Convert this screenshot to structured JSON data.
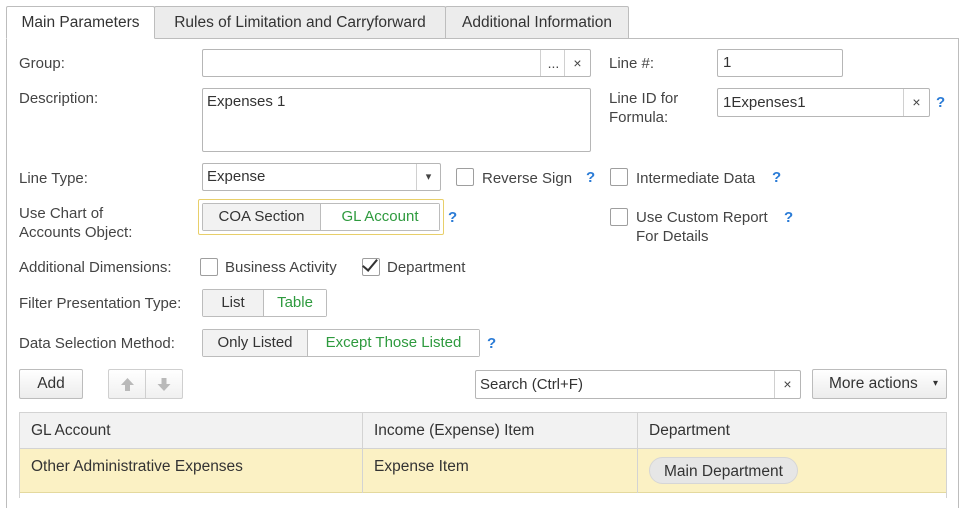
{
  "tabs": [
    {
      "label": "Main Parameters",
      "active": true
    },
    {
      "label": "Rules of Limitation and Carryforward",
      "active": false
    },
    {
      "label": "Additional Information",
      "active": false
    }
  ],
  "form": {
    "group": {
      "label": "Group:",
      "value": "",
      "select_icon": "...",
      "clear_icon": "×"
    },
    "line_no": {
      "label": "Line #:",
      "value": "1"
    },
    "description": {
      "label": "Description:",
      "value": "Expenses 1"
    },
    "line_id": {
      "label_line1": "Line ID for",
      "label_line2": "Formula:",
      "value": "1Expenses1",
      "clear_icon": "×",
      "help": "?"
    },
    "line_type": {
      "label": "Line Type:",
      "value": "Expense",
      "dropdown_icon": "▾"
    },
    "reverse_sign": {
      "label": "Reverse Sign",
      "checked": false,
      "help": "?"
    },
    "intermediate_data": {
      "label": "Intermediate Data",
      "checked": false,
      "help": "?"
    },
    "chart_object": {
      "label_line1": "Use Chart of",
      "label_line2": "Accounts Object:",
      "options": [
        "COA Section",
        "GL Account"
      ],
      "selected": "GL Account",
      "help": "?"
    },
    "custom_report": {
      "label_line1": "Use Custom Report",
      "label_line2": "For Details",
      "checked": false,
      "help": "?"
    },
    "additional_dimensions": {
      "label": "Additional Dimensions:",
      "business_activity": {
        "label": "Business Activity",
        "checked": false
      },
      "department": {
        "label": "Department",
        "checked": true
      }
    },
    "filter_presentation": {
      "label": "Filter Presentation Type:",
      "options": [
        "List",
        "Table"
      ],
      "selected": "Table"
    },
    "data_selection": {
      "label": "Data Selection Method:",
      "options": [
        "Only Listed",
        "Except Those Listed"
      ],
      "selected": "Except Those Listed",
      "help": "?"
    }
  },
  "toolbar": {
    "add_label": "Add",
    "search_placeholder": "Search (Ctrl+F)",
    "search_clear": "×",
    "more_actions_label": "More actions",
    "more_actions_icon": "▾"
  },
  "table": {
    "columns": [
      "GL Account",
      "Income (Expense) Item",
      "Department"
    ],
    "rows": [
      {
        "gl_account": "Other Administrative Expenses",
        "item": "Expense Item",
        "department": "Main Department"
      }
    ]
  },
  "colors": {
    "accent_green": "#2e9a3e",
    "help_blue": "#2a7bd6",
    "row_highlight": "#fbf1c4",
    "focus_border": "#e8cf6a"
  }
}
